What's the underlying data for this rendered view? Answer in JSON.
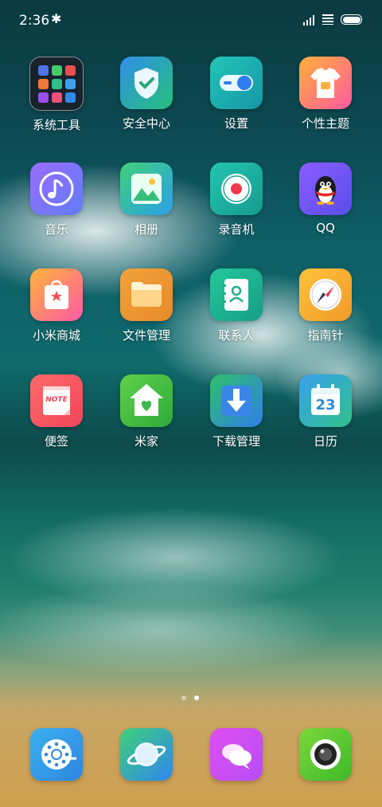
{
  "status_bar": {
    "time": "2:36"
  },
  "apps": [
    {
      "label": "系统工具",
      "icon": "folder-icon"
    },
    {
      "label": "安全中心",
      "icon": "shield-icon"
    },
    {
      "label": "设置",
      "icon": "toggle-icon"
    },
    {
      "label": "个性主题",
      "icon": "tshirt-icon"
    },
    {
      "label": "音乐",
      "icon": "music-note-icon"
    },
    {
      "label": "相册",
      "icon": "gallery-icon"
    },
    {
      "label": "录音机",
      "icon": "record-icon"
    },
    {
      "label": "QQ",
      "icon": "penguin-icon"
    },
    {
      "label": "小米商城",
      "icon": "shopping-bag-icon"
    },
    {
      "label": "文件管理",
      "icon": "folder-files-icon"
    },
    {
      "label": "联系人",
      "icon": "contacts-icon"
    },
    {
      "label": "指南针",
      "icon": "compass-icon"
    },
    {
      "label": "便签",
      "icon": "note-icon",
      "icon_text": "NOTE"
    },
    {
      "label": "米家",
      "icon": "home-icon"
    },
    {
      "label": "下载管理",
      "icon": "download-icon"
    },
    {
      "label": "日历",
      "icon": "calendar-icon",
      "icon_text": "23"
    }
  ],
  "dock": [
    {
      "icon": "phone-dial-icon"
    },
    {
      "icon": "browser-planet-icon"
    },
    {
      "icon": "messages-icon"
    },
    {
      "icon": "camera-icon"
    }
  ],
  "pages": {
    "count": 2,
    "current": 2
  }
}
